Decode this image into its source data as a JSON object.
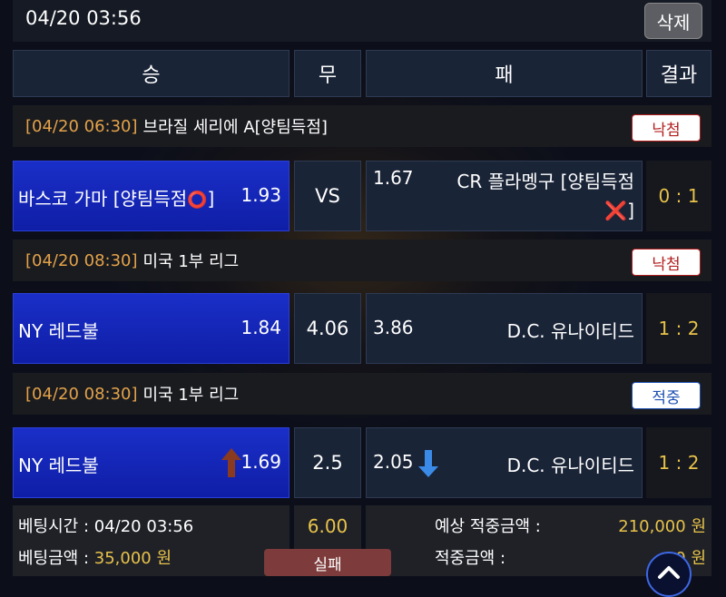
{
  "header": {
    "datetime": "04/20 03:56",
    "delete_label": "삭제"
  },
  "columns": {
    "win": "승",
    "draw": "무",
    "lose": "패",
    "result": "결과"
  },
  "games": [
    {
      "time": "[04/20 06:30]",
      "league": "브라질 세리에 A[양팀득점]",
      "status": "낙첨",
      "home_team": "바스코 가마 [양팀득점",
      "home_mark": "⭕",
      "home_suffix": "]",
      "home_odds": "1.93",
      "draw": "VS",
      "away_odds": "1.67",
      "away_team": "CR 플라멩구 [양팀득점",
      "away_mark": "❌",
      "away_suffix": "]",
      "score": "0 : 1"
    },
    {
      "time": "[04/20 08:30]",
      "league": "미국 1부 리그",
      "status": "낙첨",
      "home_team": "NY 레드불",
      "home_odds": "1.84",
      "draw": "4.06",
      "away_odds": "3.86",
      "away_team": "D.C. 유나이티드",
      "score": "1 : 2"
    },
    {
      "time": "[04/20 08:30]",
      "league": "미국 1부 리그",
      "status": "적중",
      "home_team": "NY 레드불",
      "home_odds": "1.69",
      "draw": "2.5",
      "away_odds": "2.05",
      "away_team": "D.C. 유나이티드",
      "score": "1 : 2"
    }
  ],
  "summary": {
    "bet_time_label": "베팅시간 :",
    "bet_time": "04/20 03:56",
    "bet_amount_label": "베팅금액 :",
    "bet_amount": "35,000 원",
    "total_odds": "6.00",
    "fail_label": "실패",
    "expected_label": "예상 적중금액 :",
    "expected_amount": "210,000 원",
    "won_label": "적중금액 :",
    "won_amount": "0 원"
  },
  "colors": {
    "gold": "#e8c24a",
    "win_blue": "#1a2fc8",
    "lose_red": "#b31e1e",
    "hit_blue": "#1d4fb0",
    "time_orange": "#e3a24a"
  }
}
